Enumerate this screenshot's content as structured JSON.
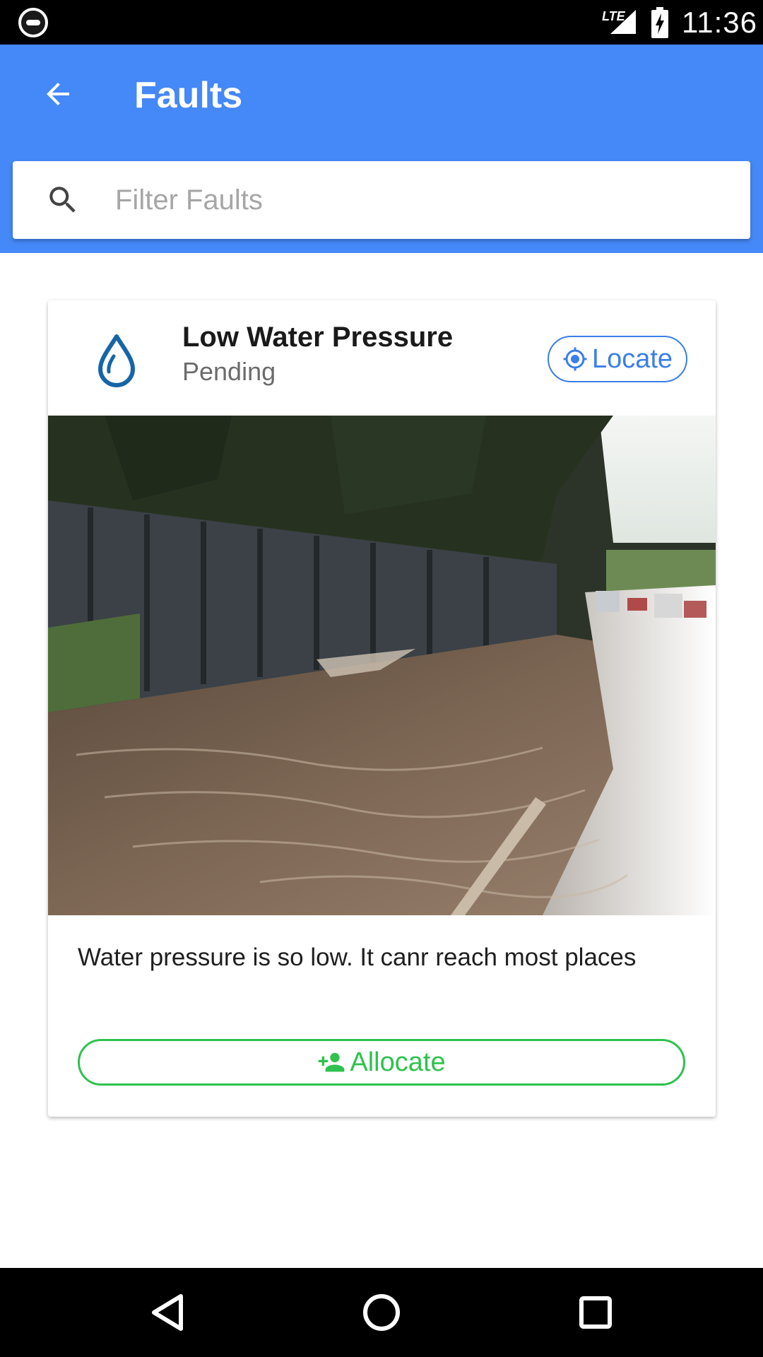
{
  "status_bar": {
    "network": "LTE",
    "time": "11:36"
  },
  "app_bar": {
    "title": "Faults"
  },
  "search": {
    "placeholder": "Filter Faults",
    "value": ""
  },
  "fault_card": {
    "icon": "water-drop-icon",
    "title": "Low Water Pressure",
    "status": "Pending",
    "locate_label": "Locate",
    "image_alt": "Water flowing over a roadside pavement",
    "description": "Water pressure is so low. It canr reach most places",
    "allocate_label": "Allocate"
  },
  "colors": {
    "primary": "#4588f7",
    "locate": "#3b7ee8",
    "allocate": "#2ec24e"
  },
  "nav": {
    "back": "back-triangle-icon",
    "home": "home-circle-icon",
    "recents": "recents-square-icon"
  }
}
